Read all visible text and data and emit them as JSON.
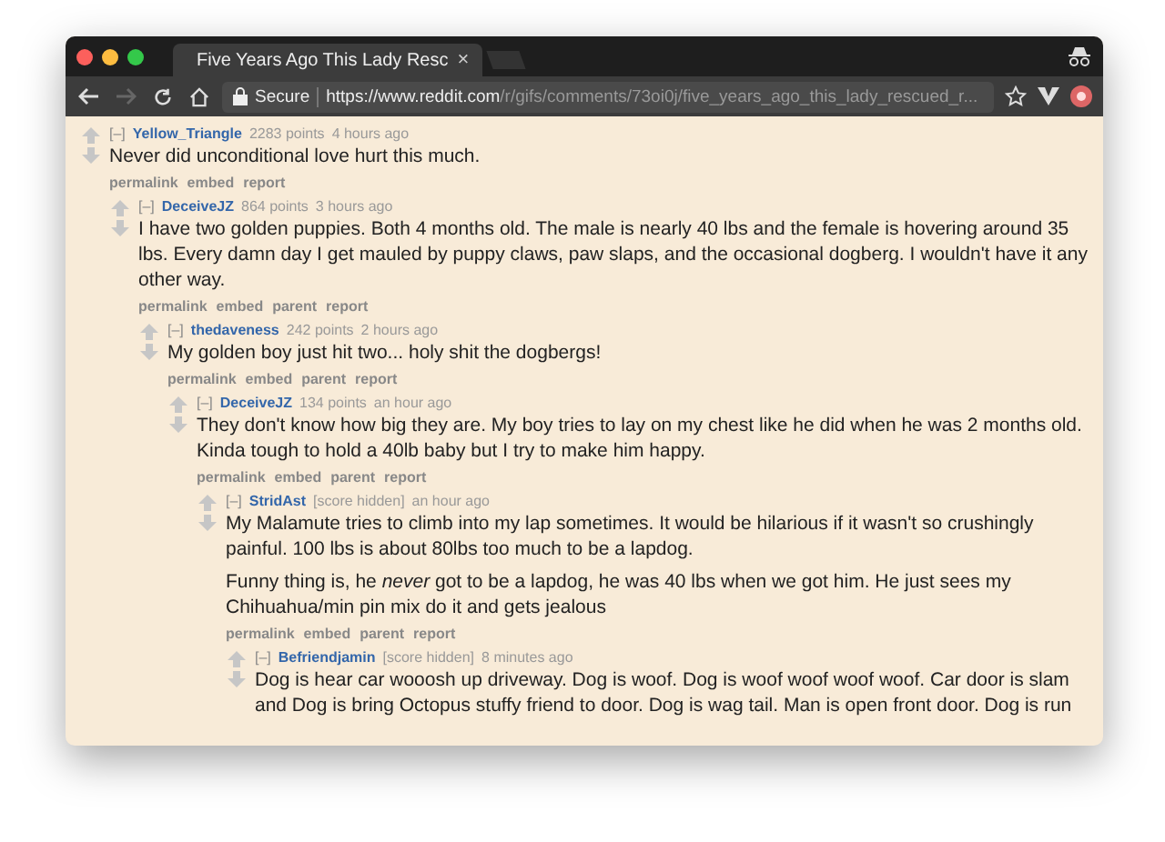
{
  "window": {
    "tab": {
      "title": "Five Years Ago This Lady Resc",
      "close": "×"
    },
    "nav": [
      {
        "kind": "back",
        "disabled": false
      },
      {
        "kind": "forward",
        "disabled": true
      },
      {
        "kind": "reload",
        "disabled": false
      },
      {
        "kind": "home",
        "disabled": false
      }
    ],
    "address": {
      "security": "Secure",
      "host": "https://www.reddit.com",
      "path": "/r/gifs/comments/73oi0j/five_years_ago_this_lady_rescued_r..."
    }
  },
  "comments": [
    {
      "collapse": "[–]",
      "author": "Yellow_Triangle",
      "score": "2283 points",
      "time": "4 hours ago",
      "paragraphs": [
        "Never did unconditional love hurt this much."
      ],
      "actions": [
        "permalink",
        "embed",
        "report"
      ],
      "children": [
        {
          "collapse": "[–]",
          "author": "DeceiveJZ",
          "score": "864 points",
          "time": "3 hours ago",
          "paragraphs": [
            "I have two golden puppies. Both 4 months old. The male is nearly 40 lbs and the female is hovering around 35 lbs. Every damn day I get mauled by puppy claws, paw slaps, and the occasional dogberg. I wouldn't have it any other way."
          ],
          "actions": [
            "permalink",
            "embed",
            "parent",
            "report"
          ],
          "children": [
            {
              "collapse": "[–]",
              "author": "thedaveness",
              "score": "242 points",
              "time": "2 hours ago",
              "paragraphs": [
                "My golden boy just hit two... holy shit the dogbergs!"
              ],
              "actions": [
                "permalink",
                "embed",
                "parent",
                "report"
              ],
              "children": [
                {
                  "collapse": "[–]",
                  "author": "DeceiveJZ",
                  "score": "134 points",
                  "time": "an hour ago",
                  "paragraphs": [
                    "They don't know how big they are. My boy tries to lay on my chest like he did when he was 2 months old. Kinda tough to hold a 40lb baby but I try to make him happy."
                  ],
                  "actions": [
                    "permalink",
                    "embed",
                    "parent",
                    "report"
                  ],
                  "children": [
                    {
                      "collapse": "[–]",
                      "author": "StridAst",
                      "score": "[score hidden]",
                      "time": "an hour ago",
                      "paragraphs": [
                        "My Malamute tries to climb into my lap sometimes. It would be hilarious if it wasn't so crushingly painful. 100 lbs is about 80lbs too much to be a lapdog.",
                        "Funny thing is, he *never* got to be a lapdog, he was 40 lbs when we got him. He just sees my Chihuahua/min pin mix do it and gets jealous"
                      ],
                      "actions": [
                        "permalink",
                        "embed",
                        "parent",
                        "report"
                      ],
                      "children": [
                        {
                          "collapse": "[–]",
                          "author": "Befriendjamin",
                          "score": "[score hidden]",
                          "time": "8 minutes ago",
                          "paragraphs": [
                            "Dog is hear car wooosh up driveway. Dog is woof. Dog is woof woof woof woof. Car door is slam and Dog is bring Octopus stuffy friend to door. Dog is wag tail. Man is open front door. Dog is run"
                          ]
                        }
                      ]
                    }
                  ]
                }
              ]
            }
          ]
        }
      ]
    }
  ]
}
